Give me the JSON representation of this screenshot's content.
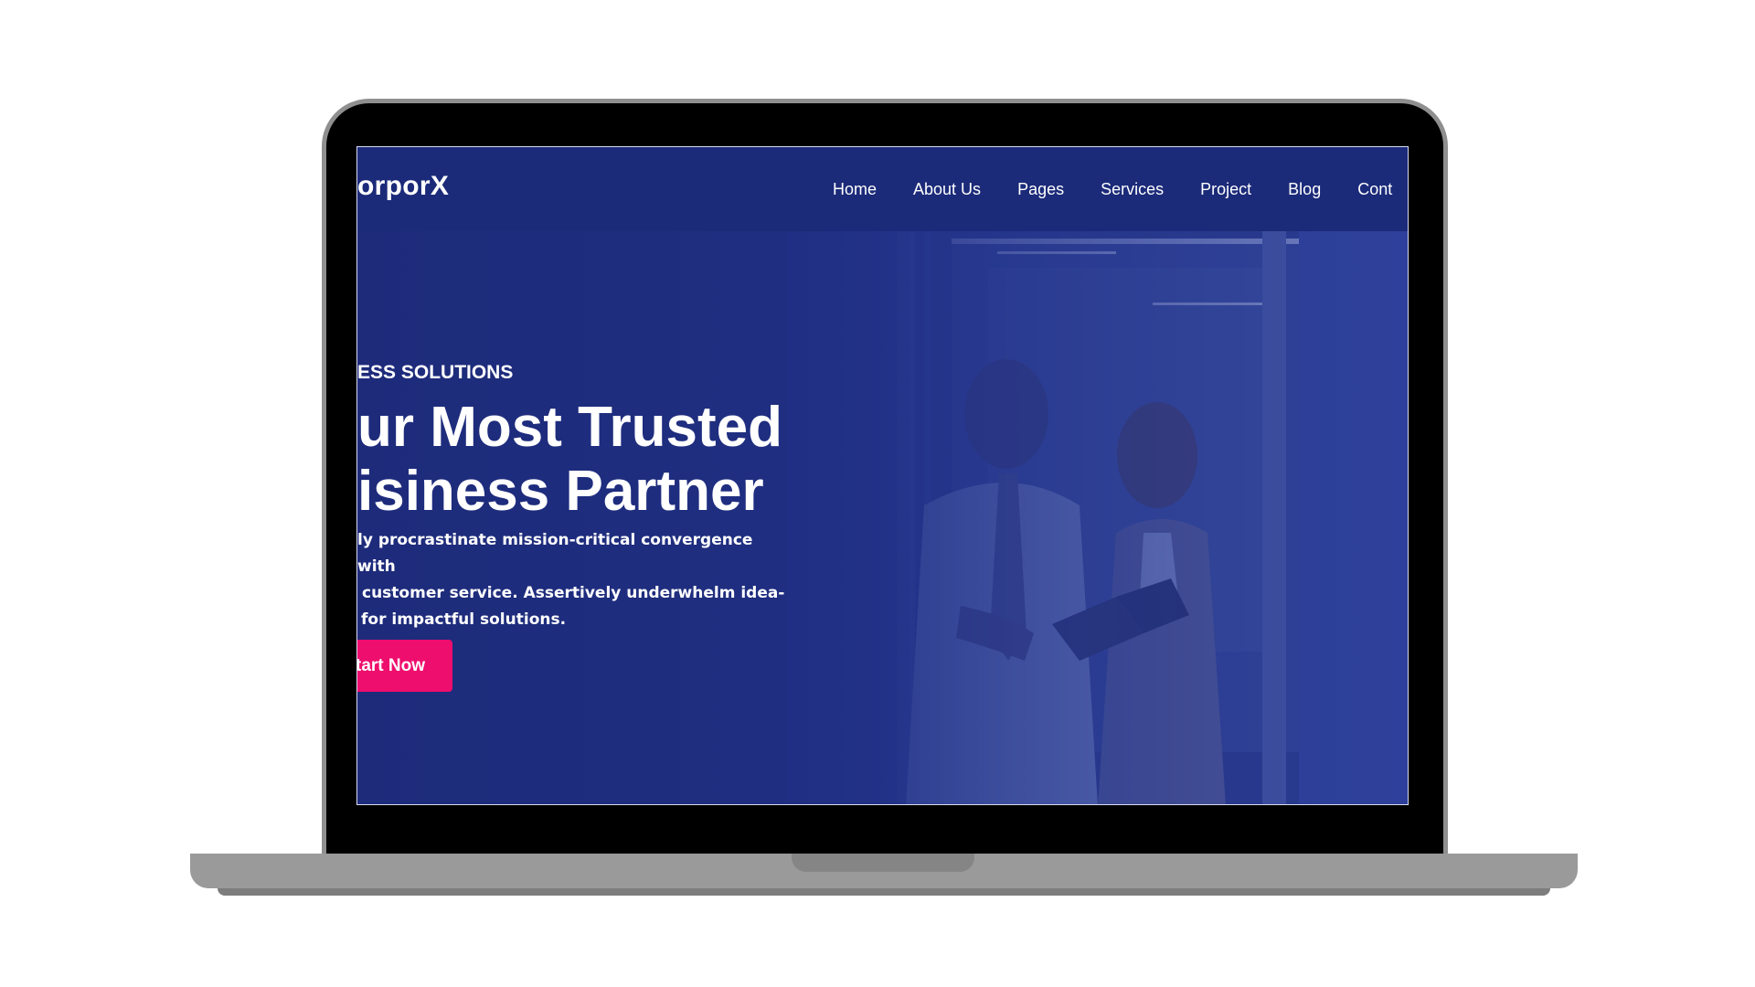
{
  "brand": {
    "logo_text": "orporX"
  },
  "nav": {
    "items": [
      {
        "label": "Home"
      },
      {
        "label": "About Us"
      },
      {
        "label": "Pages"
      },
      {
        "label": "Services"
      },
      {
        "label": "Project"
      },
      {
        "label": "Blog"
      },
      {
        "label": "Cont"
      }
    ]
  },
  "hero": {
    "eyebrow": "ESS SOLUTIONS",
    "headline_line1": "ur Most Trusted",
    "headline_line2": "isiness Partner",
    "description_line1": "ly procrastinate mission-critical convergence with",
    "description_line2": "customer service. Assertively underwhelm idea-",
    "description_line3": "for impactful solutions.",
    "cta_label": "Start Now"
  },
  "colors": {
    "nav_background": "#1b2a79",
    "hero_overlay": "#1e2c7c",
    "cta_background": "#ee0e6d",
    "text": "#ffffff"
  }
}
